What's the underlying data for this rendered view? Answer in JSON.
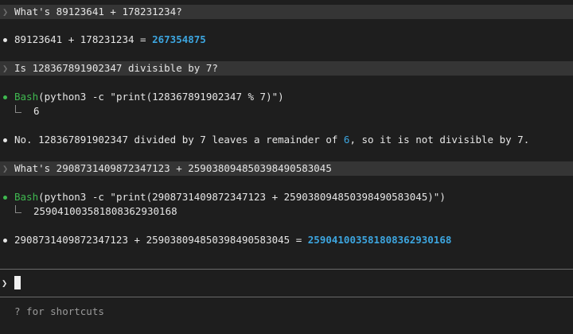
{
  "conversation": [
    {
      "prompt": "What's 89123641 + 178231234?",
      "answer_prefix": "89123641 + 178231234 = ",
      "answer_value": "267354875"
    },
    {
      "prompt": "Is 128367891902347 divisible by 7?",
      "tool_name": "Bash",
      "tool_cmd": "(python3 -c \"print(128367891902347 % 7)\")",
      "tool_output": "6",
      "answer_part1": "No. 128367891902347 divided by 7 leaves a remainder of ",
      "answer_highlight": "6",
      "answer_part2": ", so it is not divisible by 7."
    },
    {
      "prompt": "What's 2908731409872347123 + 2590380948503984905830​45",
      "tool_name": "Bash",
      "tool_cmd": "(python3 -c \"print(2908731409872347123 + 259038094850398490583045)\")",
      "tool_output": "259041003581808362930168",
      "answer_prefix": "2908731409872347123 + 259038094850398490583045 = ",
      "answer_value": "259041003581808362930168"
    }
  ],
  "input": {
    "prompt_symbol": "❯",
    "value": ""
  },
  "footer": {
    "hint": "? for shortcuts"
  },
  "icons": {
    "prompt_chevron": "chevron-right-icon",
    "bullet": "dot-icon",
    "tool_output_connector": "elbow-connector-icon"
  },
  "colors": {
    "background": "#1e1e1e",
    "prompt_row": "#353535",
    "accent": "#3da6e0",
    "tool": "#3fb950",
    "hint": "#9a9a9a"
  }
}
